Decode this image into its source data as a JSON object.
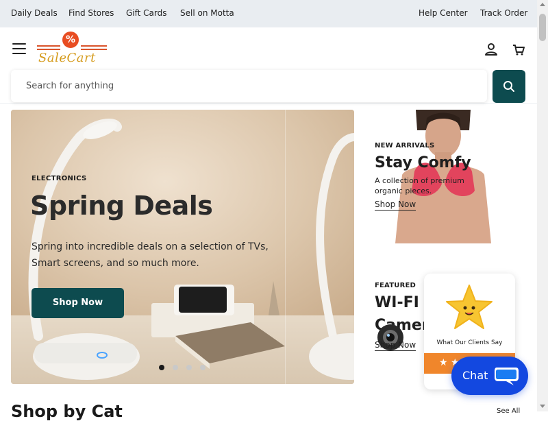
{
  "topbar": {
    "left_links": [
      "Daily Deals",
      "Find Stores",
      "Gift Cards",
      "Sell on Motta"
    ],
    "right_links": [
      "Help Center",
      "Track Order"
    ]
  },
  "header": {
    "logo_text": "SaleCart",
    "logo_badge": "%",
    "menu_icon": "hamburger-icon",
    "account_icon": "user-icon",
    "cart_icon": "cart-icon"
  },
  "search": {
    "placeholder": "Search for anything",
    "button_icon": "search-icon"
  },
  "hero": {
    "eyebrow": "ELECTRONICS",
    "title": "Spring Deals",
    "description": "Spring into incredible deals on a selection of TVs, Smart screens, and so much more.",
    "button_label": "Shop Now",
    "slides_total": 4,
    "active_slide": 1
  },
  "promos": [
    {
      "label": "NEW ARRIVALS",
      "title": "Stay Comfy",
      "description": "A collection of premium organic pieces.",
      "link": "Shop Now"
    },
    {
      "label": "FEATURED",
      "title": "WI-FI I",
      "title_line2": "Camer",
      "link": "Shop Now"
    }
  ],
  "reviews_widget": {
    "title": "What Our Clients Say",
    "stars": "★ ★"
  },
  "chat": {
    "label": "Chat",
    "icon": "chat-bubble-icon"
  },
  "section": {
    "title": "Shop by Cat",
    "link": "See All"
  },
  "colors": {
    "accent": "#0d4b4f",
    "topbar": "#e9edf1",
    "chat": "#1348e0",
    "logo_orange": "#e84d22",
    "review_bar": "#f0862b"
  }
}
